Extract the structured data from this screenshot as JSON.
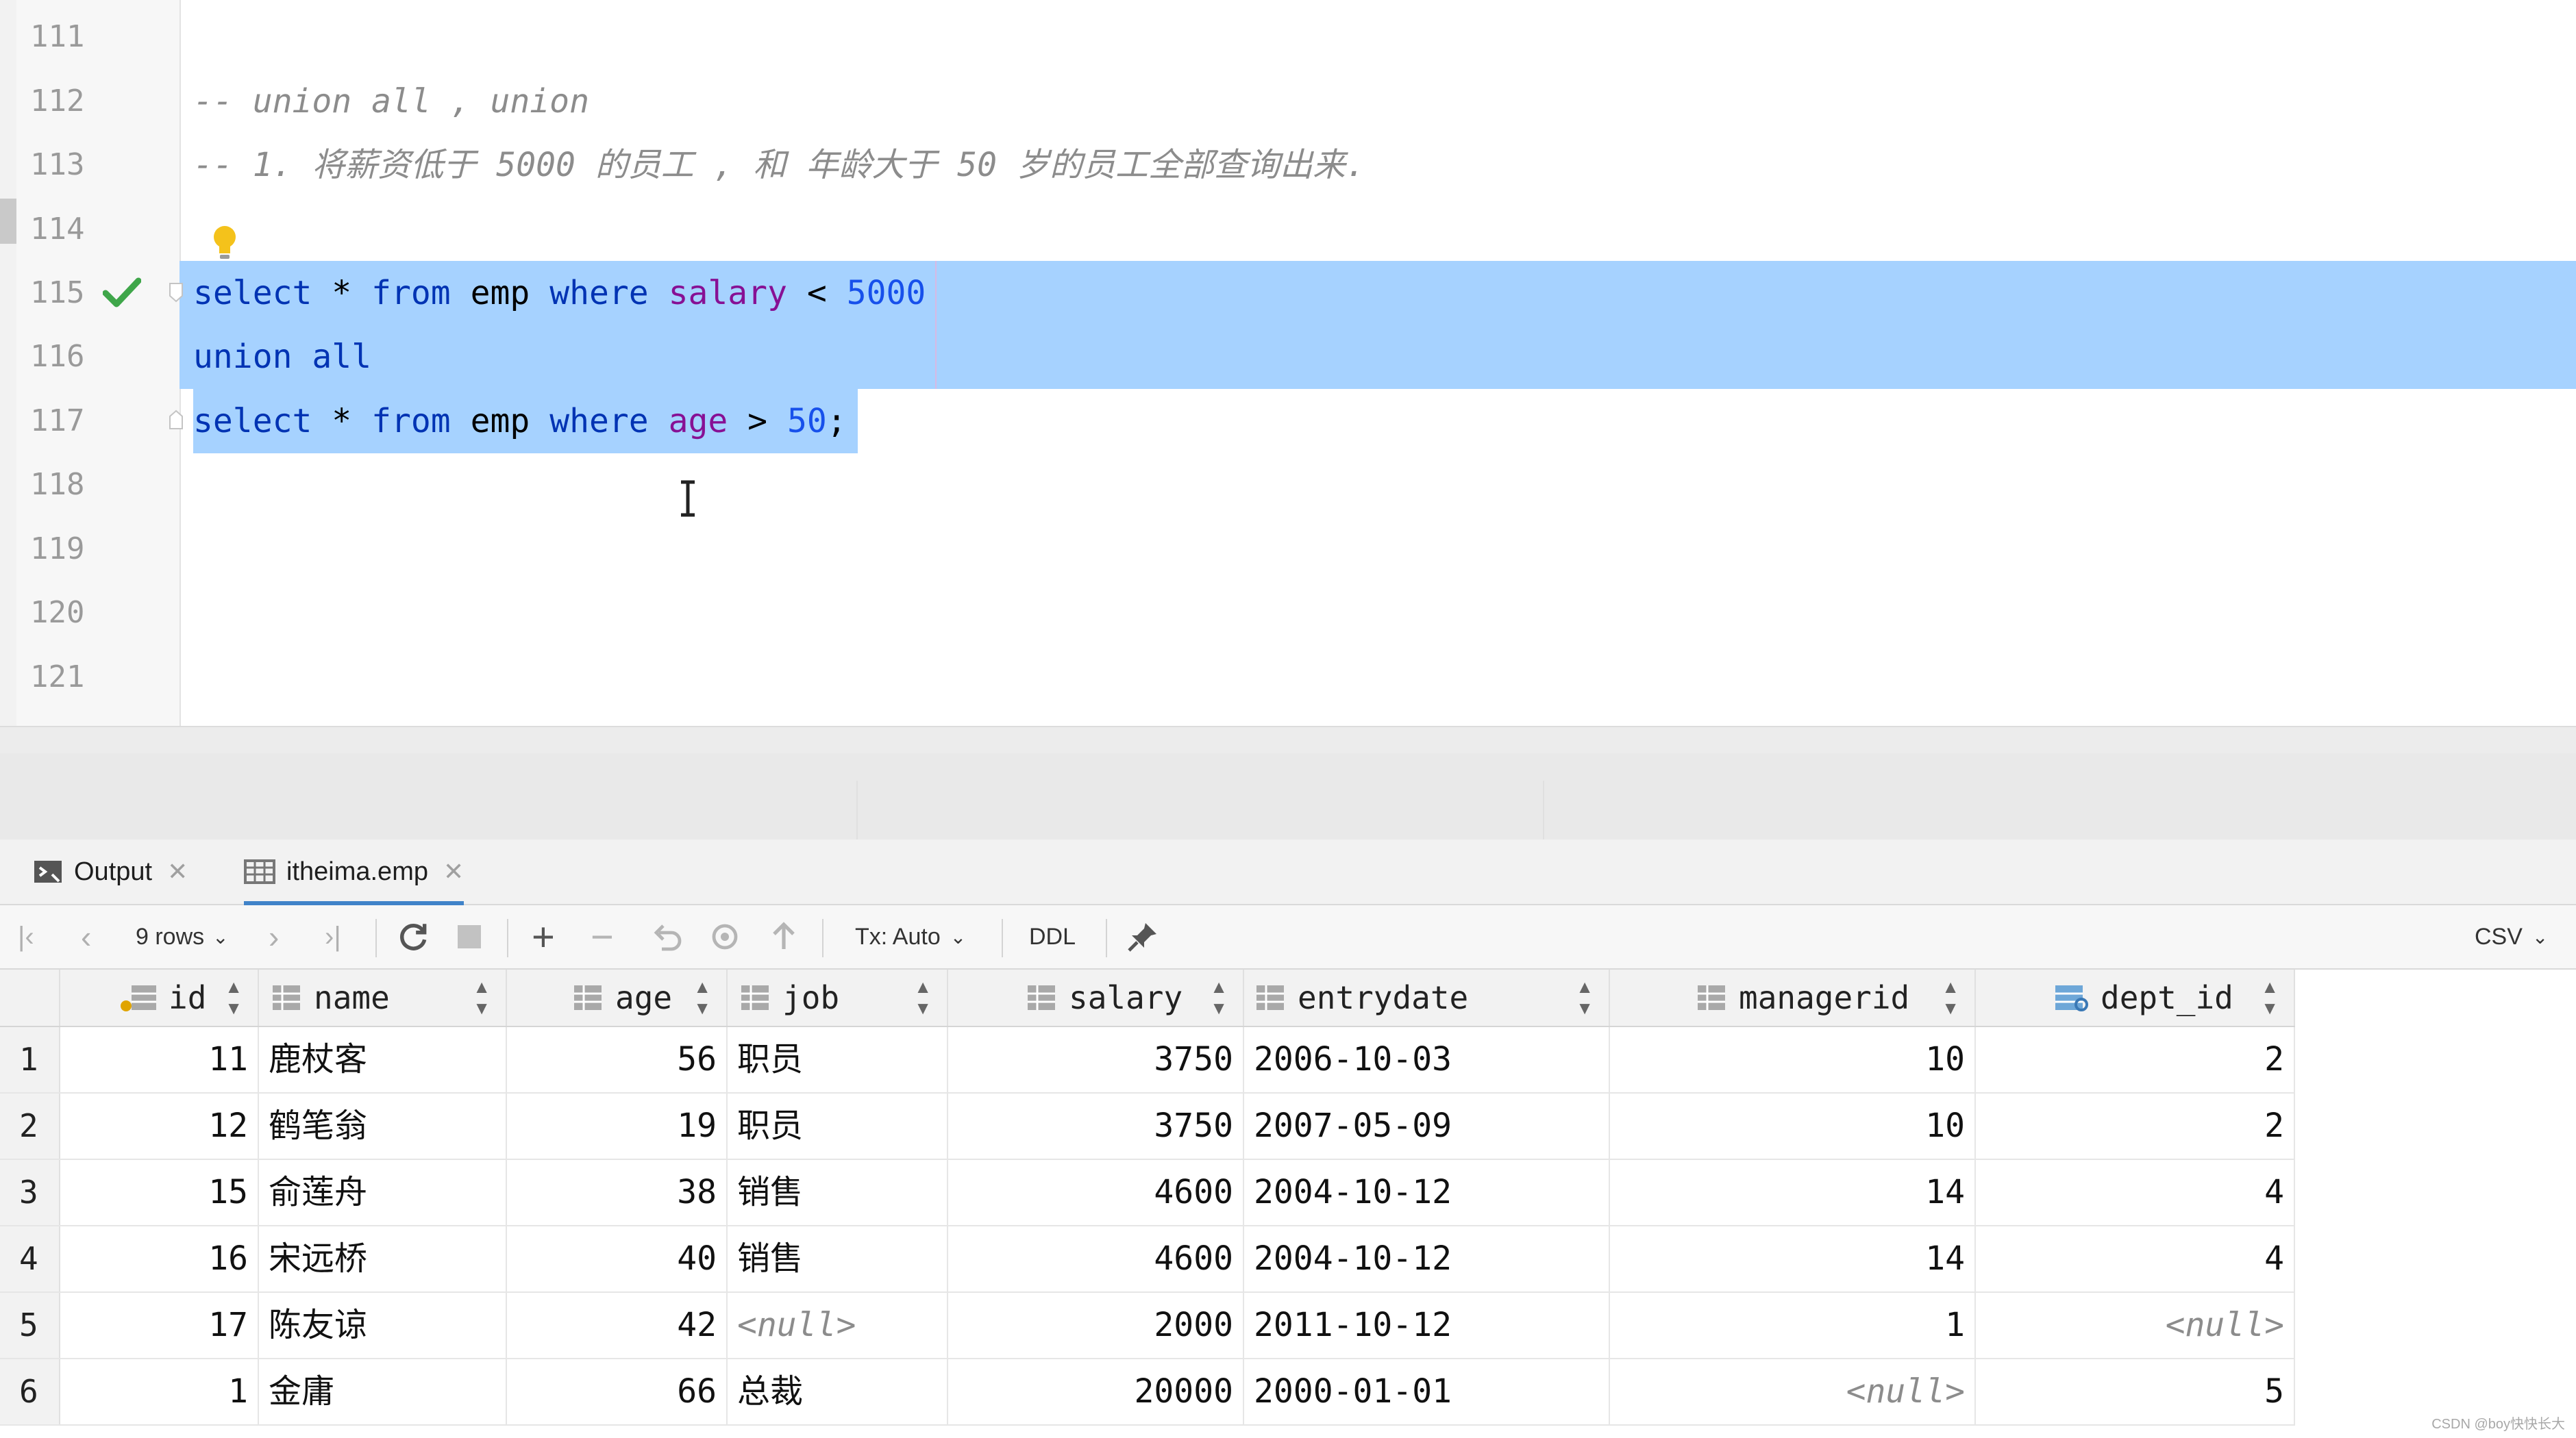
{
  "editor": {
    "line_numbers": [
      "111",
      "112",
      "113",
      "114",
      "115",
      "116",
      "117",
      "118",
      "119",
      "120",
      "121"
    ],
    "comment1": "-- union all , union",
    "comment2": "-- 1. 将薪资低于 5000 的员工 , 和 年龄大于 50 岁的员工全部查询出来.",
    "q1": {
      "select": "select",
      "star": " * ",
      "from": "from",
      "table": " emp ",
      "where": "where",
      "col": " salary",
      "op": " < ",
      "val": "5000"
    },
    "union": "union all",
    "q2": {
      "select": "select",
      "star": " * ",
      "from": "from",
      "table": " emp ",
      "where": "where",
      "col": " age",
      "op": " > ",
      "val": "50",
      "end": ";"
    }
  },
  "tabs": [
    {
      "label": "Output",
      "icon": "console-icon"
    },
    {
      "label": "itheima.emp",
      "icon": "table-icon"
    }
  ],
  "toolbar": {
    "rows_label": "9 rows",
    "tx_label": "Tx: Auto",
    "ddl_label": "DDL",
    "csv_label": "CSV"
  },
  "grid": {
    "columns": [
      "id",
      "name",
      "age",
      "job",
      "salary",
      "entrydate",
      "managerid",
      "dept_id"
    ],
    "rows": [
      {
        "n": "1",
        "id": "11",
        "name": "鹿杖客",
        "age": "56",
        "job": "职员",
        "salary": "3750",
        "entrydate": "2006-10-03",
        "managerid": "10",
        "dept_id": "2"
      },
      {
        "n": "2",
        "id": "12",
        "name": "鹤笔翁",
        "age": "19",
        "job": "职员",
        "salary": "3750",
        "entrydate": "2007-05-09",
        "managerid": "10",
        "dept_id": "2"
      },
      {
        "n": "3",
        "id": "15",
        "name": "俞莲舟",
        "age": "38",
        "job": "销售",
        "salary": "4600",
        "entrydate": "2004-10-12",
        "managerid": "14",
        "dept_id": "4"
      },
      {
        "n": "4",
        "id": "16",
        "name": "宋远桥",
        "age": "40",
        "job": "销售",
        "salary": "4600",
        "entrydate": "2004-10-12",
        "managerid": "14",
        "dept_id": "4"
      },
      {
        "n": "5",
        "id": "17",
        "name": "陈友谅",
        "age": "42",
        "job": "<null>",
        "salary": "2000",
        "entrydate": "2011-10-12",
        "managerid": "1",
        "dept_id": "<null>"
      },
      {
        "n": "6",
        "id": "1",
        "name": "金庸",
        "age": "66",
        "job": "总裁",
        "salary": "20000",
        "entrydate": "2000-01-01",
        "managerid": "<null>",
        "dept_id": "5"
      }
    ]
  },
  "watermark": "CSDN @boy快快长大",
  "colors": {
    "selection": "#a6d2ff",
    "keyword": "#0033b3",
    "column": "#871094",
    "number": "#1750eb",
    "comment": "#8c8c8c"
  }
}
